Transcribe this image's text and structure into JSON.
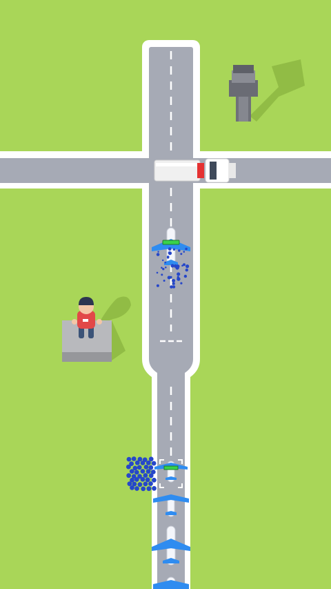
{
  "game": {
    "title": "",
    "scene": "airport-runway-top-down",
    "colors": {
      "grass": "#a9d658",
      "runway_border": "#ffffff",
      "runway": "#a6aab5",
      "lane_marking": "#ffffff",
      "shadow": "#91bc45",
      "plane_body": "#f4f6fb",
      "plane_wing": "#2f8cf0",
      "progress_bar": "#39d24a",
      "passenger": "#2647c9",
      "truck_body": "#f0f0f0",
      "truck_cab": "#ffffff",
      "truck_stripe": "#e53232",
      "platform": "#a9aaae",
      "person_shirt": "#e24848",
      "tower": "#7d7f87"
    },
    "entities": {
      "fuel_truck": "fuel-truck",
      "control_tower": "control-tower",
      "character": "player-character",
      "active_plane": "active-plane",
      "queued_planes": 4,
      "boarding_passengers": "passenger-crowd"
    }
  }
}
